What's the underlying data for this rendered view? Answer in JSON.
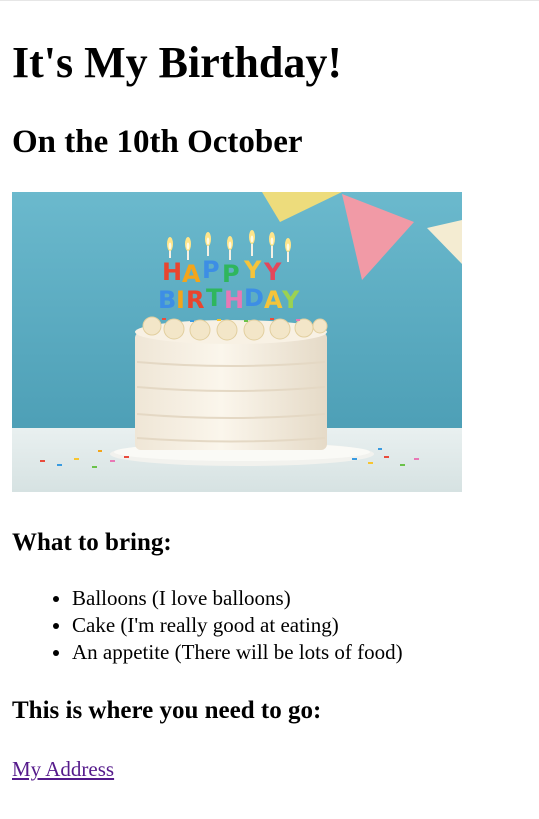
{
  "page": {
    "title": "It's My Birthday!",
    "subtitle": "On the 10th October",
    "bring_heading": "What to bring:",
    "bring_items": [
      "Balloons (I love balloons)",
      "Cake (I'm really good at eating)",
      "An appetite (There will be lots of food)"
    ],
    "where_heading": "This is where you need to go:",
    "address_link": "My Address"
  },
  "image": {
    "subject": "birthday-cake-with-candles",
    "candle_text_top": "HAPPY",
    "candle_text_bottom": "BIRTHDAY"
  },
  "colors": {
    "link_visited": "#551a8b",
    "photo_background": "#5aaec4"
  }
}
